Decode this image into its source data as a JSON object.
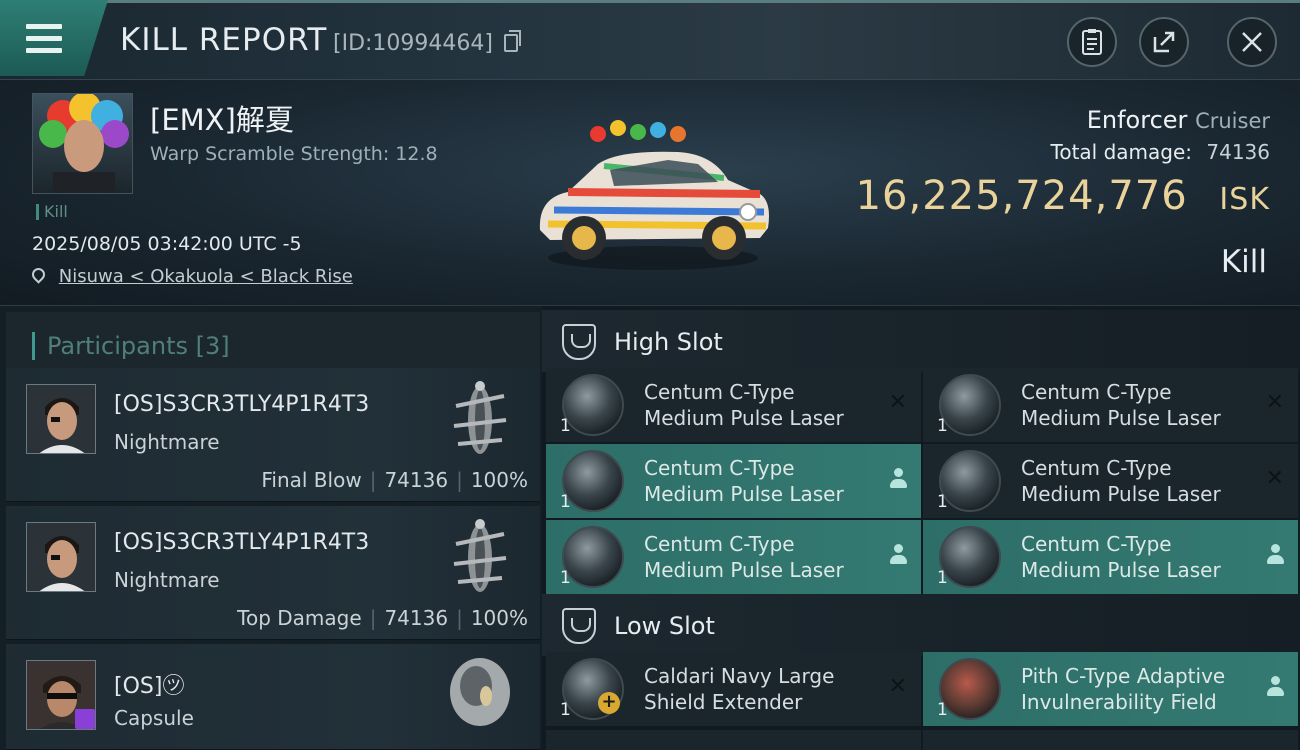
{
  "header": {
    "title": "KILL REPORT",
    "report_id": "[ID:10994464]"
  },
  "victim": {
    "pilot": "[EMX]解夏",
    "warp_scramble": "Warp Scramble Strength: 12.8",
    "kill_tag": "Kill",
    "timestamp": "2025/08/05 03:42:00 UTC -5",
    "location": "Nisuwa < Okakuola < Black Rise",
    "ship_name": "Enforcer",
    "ship_class": "Cruiser",
    "total_damage_label": "Total damage:",
    "total_damage": "74136",
    "isk_value": "16,225,724,776",
    "isk_unit": "ISK",
    "result": "Kill"
  },
  "participants": {
    "title": "Participants",
    "count": "[3]",
    "rows": [
      {
        "name": "[OS]S3CR3TLY4P1R4T3",
        "ship": "Nightmare",
        "role": "Final Blow",
        "damage": "74136",
        "percent": "100%"
      },
      {
        "name": "[OS]S3CR3TLY4P1R4T3",
        "ship": "Nightmare",
        "role": "Top Damage",
        "damage": "74136",
        "percent": "100%"
      },
      {
        "name": "[OS]㋡",
        "ship": "Capsule"
      }
    ]
  },
  "fitting": {
    "high_slot_label": "High Slot",
    "low_slot_label": "Low Slot",
    "high": [
      {
        "line1": "Centum C-Type",
        "line2": "Medium Pulse Laser",
        "qty": "1",
        "status": "destroyed"
      },
      {
        "line1": "Centum C-Type",
        "line2": "Medium Pulse Laser",
        "qty": "1",
        "status": "destroyed"
      },
      {
        "line1": "Centum C-Type",
        "line2": "Medium Pulse Laser",
        "qty": "1",
        "status": "dropped"
      },
      {
        "line1": "Centum C-Type",
        "line2": "Medium Pulse Laser",
        "qty": "1",
        "status": "destroyed"
      },
      {
        "line1": "Centum C-Type",
        "line2": "Medium Pulse Laser",
        "qty": "1",
        "status": "dropped"
      },
      {
        "line1": "Centum C-Type",
        "line2": "Medium Pulse Laser",
        "qty": "1",
        "status": "dropped"
      }
    ],
    "low": [
      {
        "line1": "Caldari Navy Large",
        "line2": "Shield Extender",
        "qty": "1",
        "status": "destroyed"
      },
      {
        "line1": "Pith C-Type Adaptive",
        "line2": "Invulnerability Field",
        "qty": "1",
        "status": "dropped"
      }
    ]
  },
  "colors": {
    "accent_teal": "#347a72",
    "isk_gold": "#e9d39b",
    "purple_badge": "#8a3fd6"
  }
}
